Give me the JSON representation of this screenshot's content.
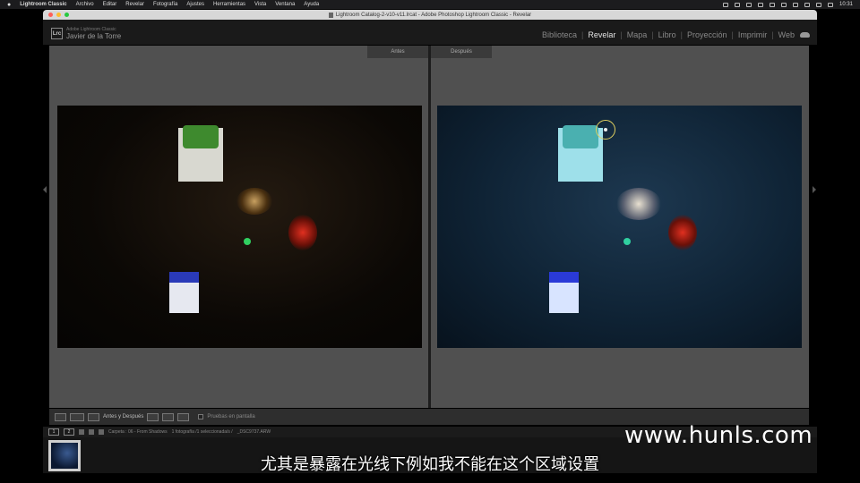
{
  "menubar": {
    "apple": "",
    "items": [
      "Lightroom Classic",
      "Archivo",
      "Editar",
      "Revelar",
      "Fotografía",
      "Ajustes",
      "Herramientas",
      "Vista",
      "Ventana",
      "Ayuda"
    ],
    "clock": "10:31"
  },
  "window": {
    "title": "Lightroom Catalog-2-v10-v11.lrcat - Adobe Photoshop Lightroom Classic - Revelar"
  },
  "identity": {
    "badge": "Lrc",
    "product": "Adobe Lightroom Classic",
    "user": "Javier de la Torre"
  },
  "modules": {
    "items": [
      "Biblioteca",
      "Revelar",
      "Mapa",
      "Libro",
      "Proyección",
      "Imprimir",
      "Web"
    ],
    "active": "Revelar"
  },
  "view": {
    "before_label": "Antes",
    "after_label": "Después"
  },
  "toolbar": {
    "mode_label": "Antes y Después",
    "proof_label": "Pruebas en pantalla"
  },
  "filmstrip": {
    "page1": "1",
    "page2": "2",
    "source": "Carpeta : 06 - From Shadows",
    "count": "1 fotografía /1 seleccionada/s /",
    "filename": "_DSC9737.ARW"
  },
  "overlay": {
    "watermark": "www.hunls.com",
    "subtitle": "尤其是暴露在光线下例如我不能在这个区域设置"
  },
  "colors": {
    "accent_active_module": "#e2e2e2",
    "panel_bg": "#505050"
  }
}
